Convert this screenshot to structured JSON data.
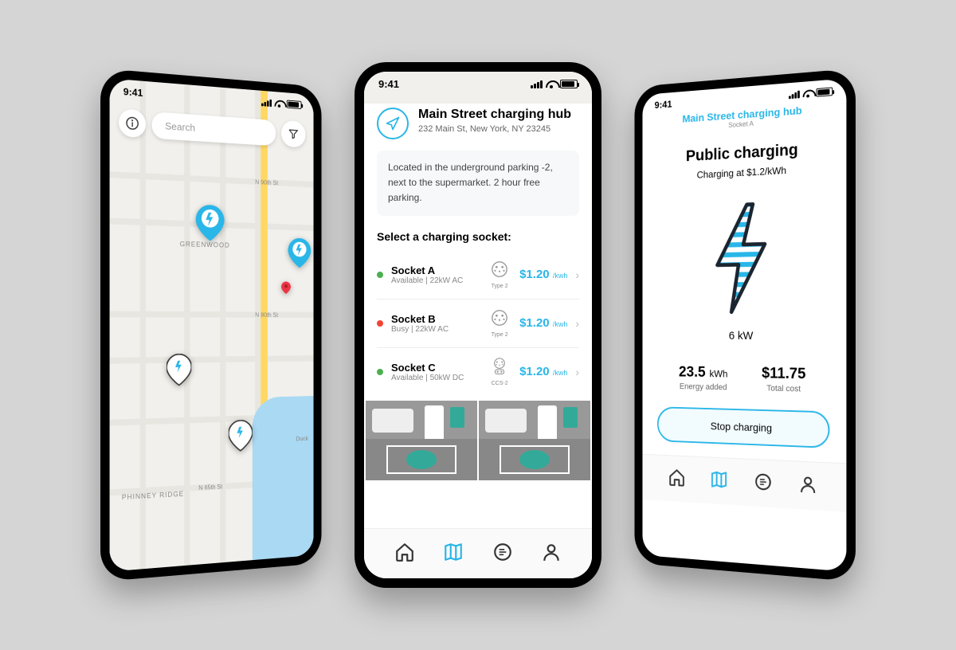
{
  "status": {
    "time": "9:41"
  },
  "phone1": {
    "search_placeholder": "Search",
    "area": "GREENWOOD",
    "streets": [
      "N 80th St",
      "N 90th St",
      "N 65th St",
      "PHINNEY RIDGE",
      "Duck"
    ]
  },
  "phone2": {
    "hub_name": "Main Street charging hub",
    "hub_address": "232 Main St, New York, NY 23245",
    "info_text": "Located in the underground parking -2, next to the supermarket. 2 hour free parking.",
    "section_title": "Select a charging socket:",
    "sockets": [
      {
        "name": "Socket A",
        "status": "Available",
        "power": "22kW AC",
        "plug": "Type 2",
        "price": "$1.20",
        "unit": "/kwh",
        "dot": "green"
      },
      {
        "name": "Socket B",
        "status": "Busy",
        "power": "22kW AC",
        "plug": "Type 2",
        "price": "$1.20",
        "unit": "/kwh",
        "dot": "red"
      },
      {
        "name": "Socket C",
        "status": "Available",
        "power": "50kW DC",
        "plug": "CCS-2",
        "price": "$1.20",
        "unit": "/kwh",
        "dot": "green"
      }
    ]
  },
  "phone3": {
    "hub_name": "Main Street charging hub",
    "socket": "Socket A",
    "title": "Public charging",
    "rate": "Charging at $1.2/kWh",
    "power": "6 kW",
    "energy_val": "23.5",
    "energy_unit": "kWh",
    "energy_label": "Energy added",
    "cost_val": "$11.75",
    "cost_label": "Total cost",
    "stop_label": "Stop charging"
  }
}
